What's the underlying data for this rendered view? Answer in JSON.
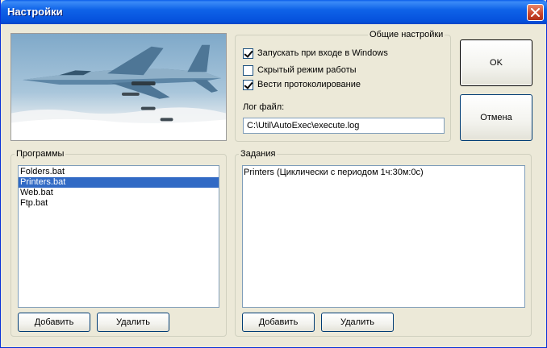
{
  "window": {
    "title": "Настройки"
  },
  "general": {
    "legend": "Общие настройки",
    "options": [
      {
        "label": "Запускать при входе в Windows",
        "checked": true
      },
      {
        "label": "Скрытый режим работы",
        "checked": false
      },
      {
        "label": "Вести протоколирование",
        "checked": true
      }
    ],
    "log_label": "Лог файл:",
    "log_path": "C:\\Util\\AutoExec\\execute.log"
  },
  "buttons": {
    "ok": "OK",
    "cancel": "Отмена"
  },
  "programs": {
    "legend": "Программы",
    "items": [
      "Folders.bat",
      "Printers.bat",
      "Web.bat",
      "Ftp.bat"
    ],
    "selected_index": 1,
    "add": "Добавить",
    "remove": "Удалить"
  },
  "tasks": {
    "legend": "Задания",
    "items": [
      "Printers (Циклически с периодом 1ч:30м:0с)"
    ],
    "add": "Добавить",
    "remove": "Удалить"
  },
  "colors": {
    "titlebar": "#0550DC",
    "selection": "#316AC5",
    "face": "#ECE9D8"
  },
  "icons": {
    "close": "close-icon",
    "photo": "fighter-jet-photo"
  }
}
